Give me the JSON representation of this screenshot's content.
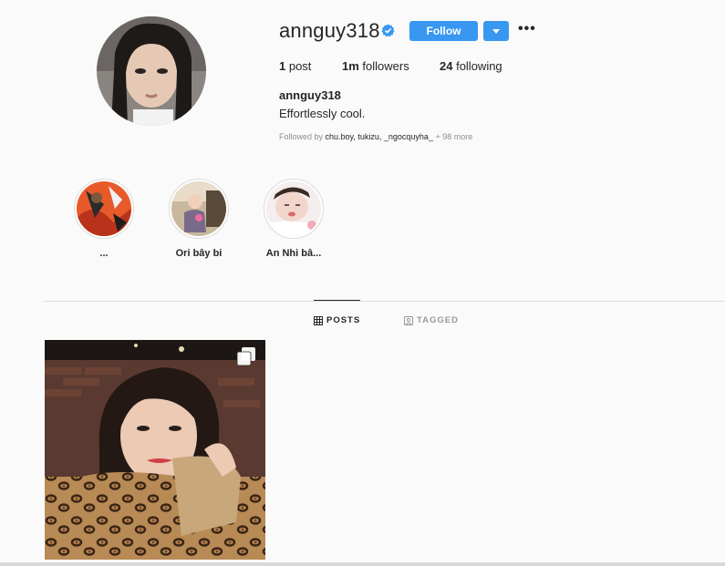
{
  "profile": {
    "username": "annguy318",
    "follow_label": "Follow",
    "dropdown_icon": "caret-down-icon",
    "more_label": "•••",
    "verified_icon": "verified-badge-icon",
    "full_name": "annguy318",
    "bio": "Effortlessly cool.",
    "followed_by_prefix": "Followed by ",
    "followed_by_names": "chu.boy, tukizu, _ngocquyha_",
    "followed_by_more": " + 98 more"
  },
  "stats": [
    {
      "count": "1",
      "label": " post"
    },
    {
      "count": "1m",
      "label": " followers"
    },
    {
      "count": "24",
      "label": " following"
    }
  ],
  "highlights": [
    {
      "label": "..."
    },
    {
      "label": "Ori bây bi"
    },
    {
      "label": "An Nhi bâ..."
    }
  ],
  "tabs": [
    {
      "label": "POSTS",
      "active": true
    },
    {
      "label": "TAGGED",
      "active": false
    }
  ],
  "colors": {
    "accent": "#3897f0",
    "background": "#fafafa",
    "text": "#262626",
    "muted": "#8e8e8e"
  }
}
